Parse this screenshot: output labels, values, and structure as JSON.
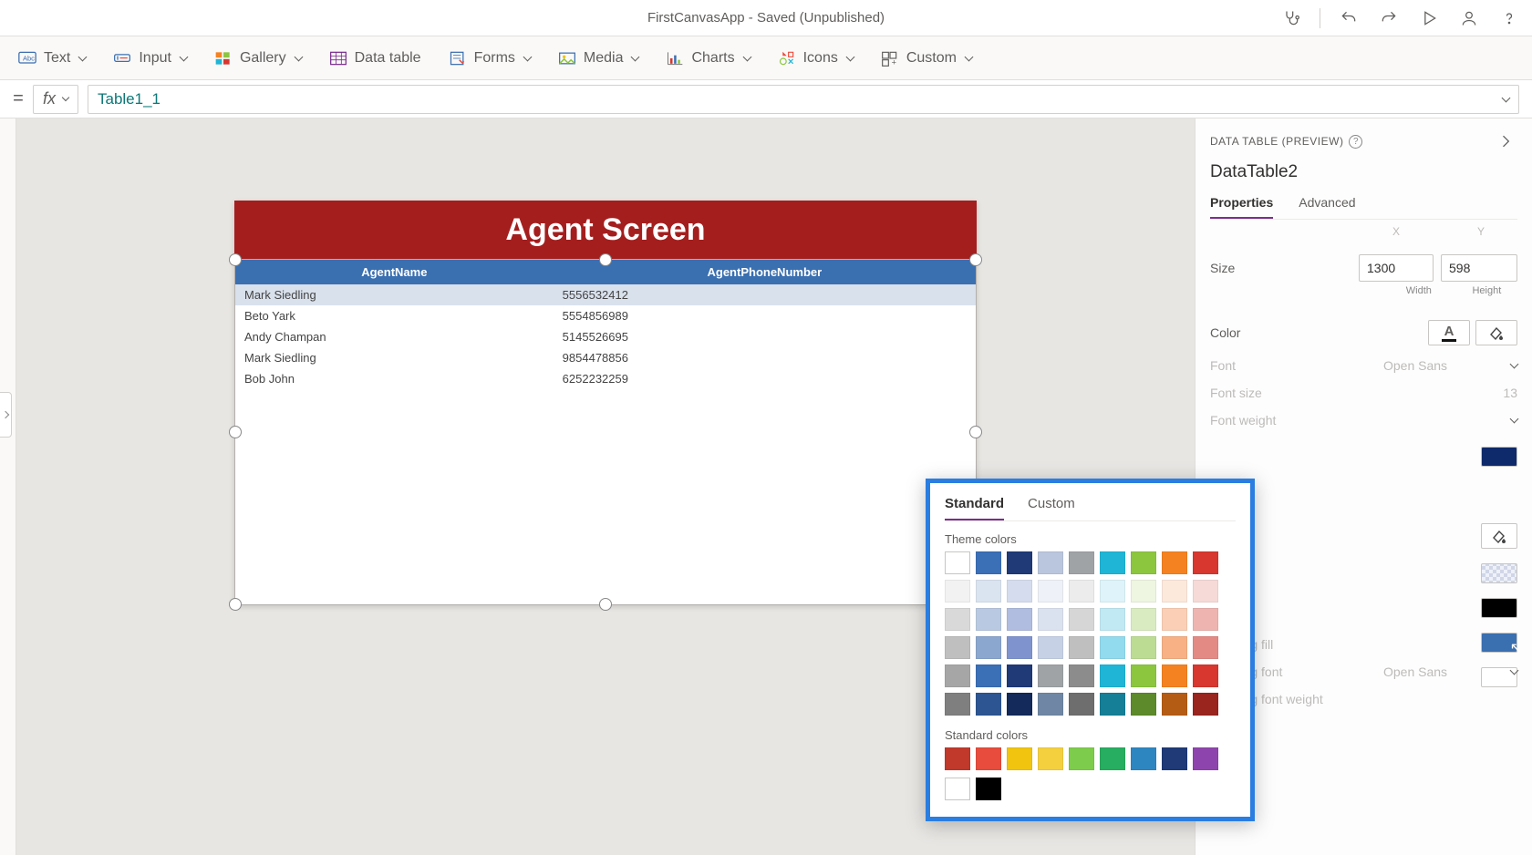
{
  "titlebar": {
    "title": "FirstCanvasApp - Saved (Unpublished)",
    "icons": [
      "stethoscope-icon",
      "undo-icon",
      "redo-icon",
      "play-icon",
      "user-icon",
      "help-icon"
    ]
  },
  "ribbon": {
    "items": [
      {
        "label": "Text",
        "icon": "text"
      },
      {
        "label": "Input",
        "icon": "input"
      },
      {
        "label": "Gallery",
        "icon": "gallery"
      },
      {
        "label": "Data table",
        "icon": "datatable",
        "no_chev": true
      },
      {
        "label": "Forms",
        "icon": "forms"
      },
      {
        "label": "Media",
        "icon": "media"
      },
      {
        "label": "Charts",
        "icon": "charts"
      },
      {
        "label": "Icons",
        "icon": "icons"
      },
      {
        "label": "Custom",
        "icon": "custom"
      }
    ]
  },
  "formula": {
    "prefix": "=",
    "fx": "fx",
    "value": "Table1_1"
  },
  "canvas": {
    "header": "Agent Screen",
    "columns": [
      "AgentName",
      "AgentPhoneNumber"
    ],
    "rows": [
      {
        "name": "Mark Siedling",
        "phone": "5556532412",
        "selected": true
      },
      {
        "name": "Beto Yark",
        "phone": "5554856989"
      },
      {
        "name": "Andy Champan",
        "phone": "5145526695"
      },
      {
        "name": "Mark Siedling",
        "phone": "9854478856"
      },
      {
        "name": "Bob John",
        "phone": "6252232259"
      }
    ]
  },
  "properties": {
    "panel_title": "DATA TABLE (PREVIEW)",
    "control_name": "DataTable2",
    "tabs": {
      "properties": "Properties",
      "advanced": "Advanced"
    },
    "size_label": "Size",
    "width_value": "1300",
    "height_value": "598",
    "width_label": "Width",
    "height_label": "Height",
    "color_label": "Color",
    "font_label": "Font",
    "font_value": "Open Sans",
    "fontsize_label": "Font size",
    "fontsize_value": "13",
    "fontweight_label": "Font weight",
    "heading_fill_label": "Heading fill",
    "heading_font_label": "Heading font",
    "heading_font_value": "Open Sans",
    "heading_fontweight_label": "Heading font weight",
    "right_swatches": [
      "#0f2a6b",
      "#e4e8f4",
      "#000000",
      "#3a6fb0",
      "#ffffff"
    ]
  },
  "colorpicker": {
    "tab_standard": "Standard",
    "tab_custom": "Custom",
    "theme_label": "Theme colors",
    "standard_label": "Standard colors",
    "theme_rows": [
      [
        "#ffffff",
        "#3b6fb6",
        "#1f3a77",
        "#b9c6de",
        "#9fa3a6",
        "#1fb5d6",
        "#8cc63f",
        "#f58220",
        "#d7372f"
      ],
      [
        "#f2f2f2",
        "#dae3f0",
        "#d5dced",
        "#eef1f7",
        "#ececec",
        "#def4fa",
        "#eef5e1",
        "#fde8dc",
        "#f6dad8"
      ],
      [
        "#d9d9d9",
        "#b9c9e2",
        "#b0bde0",
        "#dbe2ef",
        "#d6d6d6",
        "#c0e9f4",
        "#d9ebc0",
        "#fbcfb5",
        "#edb4b0"
      ],
      [
        "#bfbfbf",
        "#8ba6cf",
        "#7f94cf",
        "#c6d1e6",
        "#bfbfbf",
        "#92daee",
        "#bddc93",
        "#f7b184",
        "#e48a84"
      ],
      [
        "#a6a6a6",
        "#3b6fb6",
        "#1f3a77",
        "#9fa3a6",
        "#8c8c8c",
        "#1fb5d6",
        "#8cc63f",
        "#f58220",
        "#d7372f"
      ],
      [
        "#7f7f7f",
        "#2c5592",
        "#132a5a",
        "#6f87a4",
        "#6e6e6e",
        "#157f97",
        "#5d8a2a",
        "#b55c14",
        "#9a241e"
      ]
    ],
    "standard_row": [
      "#c0392b",
      "#e74c3c",
      "#f1c40f",
      "#f4d03f",
      "#7dcc4b",
      "#27ae60",
      "#2e86c1",
      "#1f3a77",
      "#8e44ad"
    ],
    "bw_row": [
      "#ffffff",
      "#000000"
    ]
  }
}
